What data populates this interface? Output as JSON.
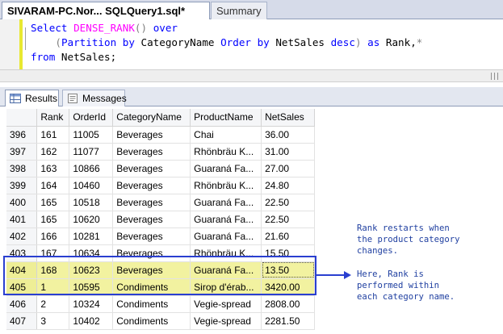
{
  "tabs": {
    "active": "SIVARAM-PC.Nor... SQLQuery1.sql*",
    "inactive": "Summary"
  },
  "editor": {
    "line1": {
      "kw1": "Select",
      "fn": "DENSE_RANK",
      "paren": "()",
      "kw2": "over"
    },
    "line2": {
      "open": "(",
      "kw1": "Partition by",
      "col1": " CategoryName ",
      "kw2": "Order by",
      "col2": " NetSales ",
      "kw3": "desc",
      "close": ")",
      "kw4": "as",
      "alias": " Rank,",
      "trail": "*"
    },
    "line3": {
      "kw": "from",
      "table": " NetSales;"
    }
  },
  "results_tabs": {
    "results": "Results",
    "messages": "Messages"
  },
  "grid": {
    "columns": [
      "",
      "Rank",
      "OrderId",
      "CategoryName",
      "ProductName",
      "NetSales"
    ],
    "rows": [
      [
        "396",
        "161",
        "11005",
        "Beverages",
        "Chai",
        "36.00"
      ],
      [
        "397",
        "162",
        "11077",
        "Beverages",
        "Rhönbräu K...",
        "31.00"
      ],
      [
        "398",
        "163",
        "10866",
        "Beverages",
        "Guaraná Fa...",
        "27.00"
      ],
      [
        "399",
        "164",
        "10460",
        "Beverages",
        "Rhönbräu K...",
        "24.80"
      ],
      [
        "400",
        "165",
        "10518",
        "Beverages",
        "Guaraná Fa...",
        "22.50"
      ],
      [
        "401",
        "165",
        "10620",
        "Beverages",
        "Guaraná Fa...",
        "22.50"
      ],
      [
        "402",
        "166",
        "10281",
        "Beverages",
        "Guaraná Fa...",
        "21.60"
      ],
      [
        "403",
        "167",
        "10634",
        "Beverages",
        "Rhönbräu K...",
        "15.50"
      ],
      [
        "404",
        "168",
        "10623",
        "Beverages",
        "Guaraná Fa...",
        "13.50"
      ],
      [
        "405",
        "1",
        "10595",
        "Condiments",
        "Sirop d'érab...",
        "3420.00"
      ],
      [
        "406",
        "2",
        "10324",
        "Condiments",
        "Vegie-spread",
        "2808.00"
      ],
      [
        "407",
        "3",
        "10402",
        "Condiments",
        "Vegie-spread",
        "2281.50"
      ]
    ]
  },
  "annotation": {
    "text1": "Rank restarts when\nthe product category\nchanges.",
    "text2": "Here, Rank is\nperformed within\neach category name."
  },
  "colors": {
    "highlight_row": "#f2f2a0",
    "highlight_box": "#2a3fd0",
    "annotation_text": "#1f3fa0"
  }
}
